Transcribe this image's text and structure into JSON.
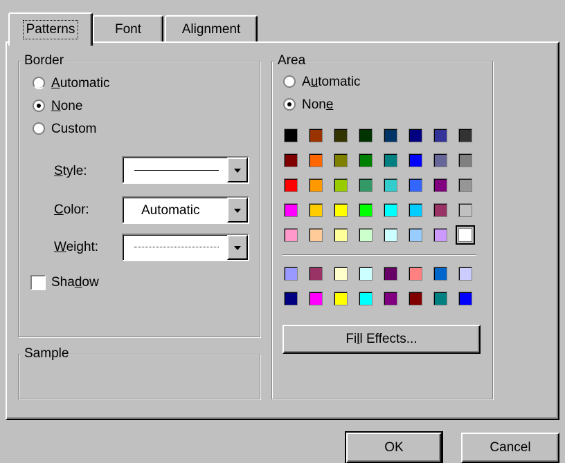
{
  "tabs": [
    {
      "label": "Patterns",
      "active": true
    },
    {
      "label": "Font",
      "active": false
    },
    {
      "label": "Alignment",
      "active": false
    }
  ],
  "border": {
    "title": "Border",
    "options": [
      {
        "pre": "",
        "ul": "A",
        "post": "utomatic",
        "selected": false
      },
      {
        "pre": "",
        "ul": "N",
        "post": "one",
        "selected": true
      },
      {
        "pre": "",
        "ul": "",
        "post": "Custom",
        "selected": false
      }
    ],
    "style_label": {
      "pre": "",
      "ul": "S",
      "post": "tyle:"
    },
    "color_label": {
      "pre": "",
      "ul": "C",
      "post": "olor:"
    },
    "weight_label": {
      "pre": "",
      "ul": "W",
      "post": "eight:"
    },
    "color_value": "Automatic",
    "shadow_label": {
      "pre": "Sha",
      "ul": "d",
      "post": "ow"
    },
    "shadow_checked": false
  },
  "sample": {
    "title": "Sample"
  },
  "area": {
    "title": "Area",
    "options": [
      {
        "pre": "A",
        "ul": "u",
        "post": "tomatic",
        "selected": false
      },
      {
        "pre": "Non",
        "ul": "e",
        "post": "",
        "selected": true
      }
    ],
    "palette_main": [
      [
        "#000000",
        "#993300",
        "#333300",
        "#003300",
        "#003366",
        "#000080",
        "#333399",
        "#333333"
      ],
      [
        "#800000",
        "#ff6600",
        "#808000",
        "#008000",
        "#008080",
        "#0000ff",
        "#666699",
        "#808080"
      ],
      [
        "#ff0000",
        "#ff9900",
        "#99cc00",
        "#339966",
        "#33cccc",
        "#3366ff",
        "#800080",
        "#969696"
      ],
      [
        "#ff00ff",
        "#ffcc00",
        "#ffff00",
        "#00ff00",
        "#00ffff",
        "#00ccff",
        "#993366",
        "#c0c0c0"
      ],
      [
        "#ff99cc",
        "#ffcc99",
        "#ffff99",
        "#ccffcc",
        "#ccffff",
        "#99ccff",
        "#cc99ff",
        "#ffffff"
      ]
    ],
    "palette_extra": [
      [
        "#9999ff",
        "#993366",
        "#ffffcc",
        "#ccffff",
        "#660066",
        "#ff8080",
        "#0066cc",
        "#ccccff"
      ],
      [
        "#000080",
        "#ff00ff",
        "#ffff00",
        "#00ffff",
        "#800080",
        "#800000",
        "#008080",
        "#0000ff"
      ]
    ],
    "fill_effects": {
      "pre": "Fi",
      "ul": "l",
      "post": "l Effects..."
    }
  },
  "buttons": {
    "ok": "OK",
    "cancel": "Cancel"
  }
}
